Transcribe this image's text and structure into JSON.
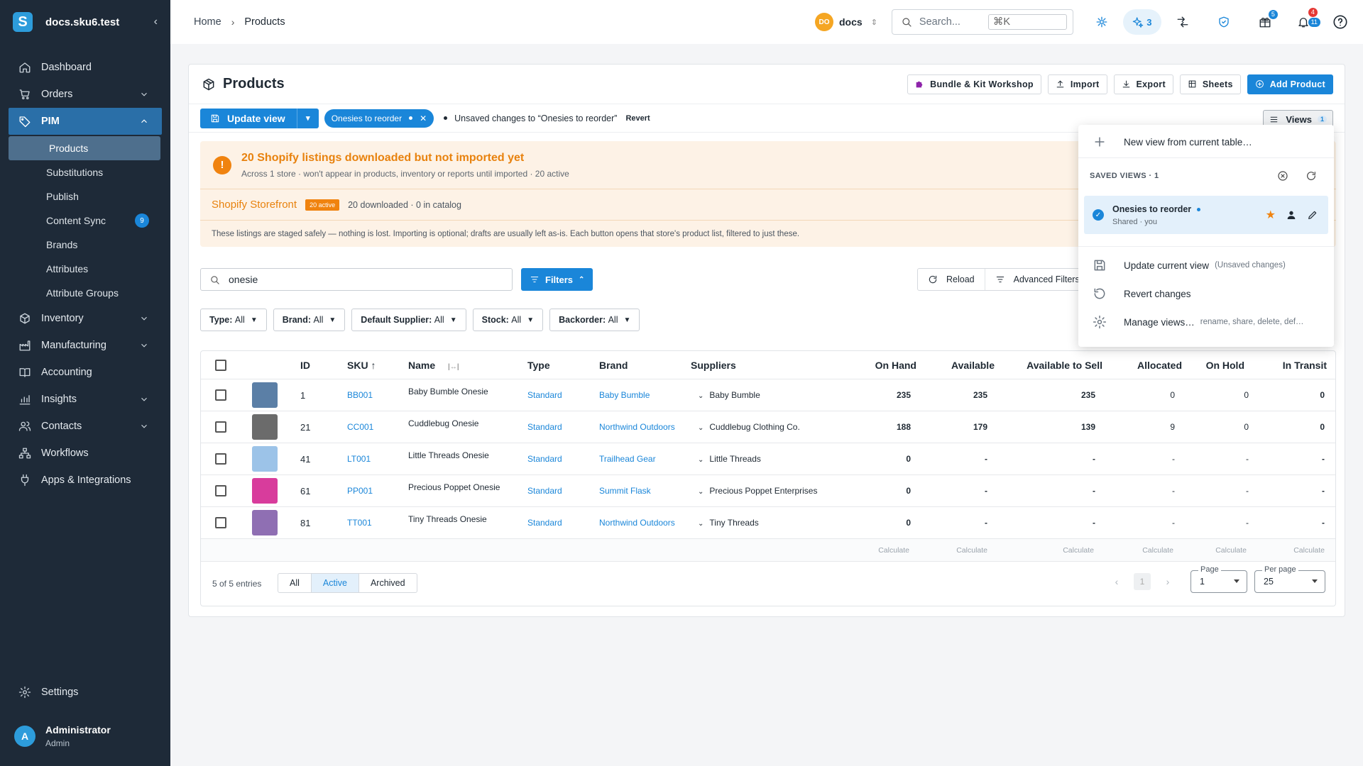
{
  "sidebar": {
    "logo": "S",
    "title": "docs.sku6.test",
    "collapse": "‹",
    "nav": [
      {
        "label": "Dashboard",
        "icon": "home-icon"
      },
      {
        "label": "Orders",
        "icon": "cart-icon"
      },
      {
        "label": "PIM",
        "icon": "tag-icon"
      },
      {
        "label": "Inventory",
        "icon": "box-icon"
      },
      {
        "label": "Manufacturing",
        "icon": "factory-icon"
      },
      {
        "label": "Accounting",
        "icon": "book-icon"
      },
      {
        "label": "Insights",
        "icon": "chart-icon"
      },
      {
        "label": "Contacts",
        "icon": "contacts-icon"
      },
      {
        "label": "Workflows",
        "icon": "workflow-icon"
      },
      {
        "label": "Apps & Integrations",
        "icon": "plug-icon"
      }
    ],
    "pim_sub": [
      "Products",
      "Substitutions",
      "Publish",
      "Content Sync",
      "Brands",
      "Attributes",
      "Attribute Groups"
    ],
    "content_sync_badge": "9",
    "settings": "Settings",
    "user": {
      "initial": "A",
      "name": "Administrator",
      "role": "Admin"
    }
  },
  "topbar": {
    "crumbs": [
      "Home",
      "Products"
    ],
    "crumb_sep": "›",
    "workspace": {
      "initials": "DO",
      "name": "docs"
    },
    "search_placeholder": "Search...",
    "search_kbd": "⌘K",
    "ai_count": "3",
    "gift_badge": "5",
    "notif_badge_top": "4",
    "notif_badge_bottom": "11"
  },
  "page": {
    "title": "Products",
    "buttons": {
      "bundle": "Bundle & Kit Workshop",
      "import": "Import",
      "export": "Export",
      "sheets": "Sheets",
      "add": "Add Product"
    },
    "update_view": "Update view",
    "view_chip": "Onesies to reorder",
    "unsaved_text": "Unsaved changes to “Onesies to reorder”",
    "revert": "Revert",
    "views_label": "Views",
    "views_count": "1"
  },
  "alert": {
    "title": "20 Shopify listings downloaded but not imported yet",
    "subtitle": "Across 1 store · won't appear in products, inventory or reports until imported · 20 active",
    "store": "Shopify Storefront",
    "store_badge": "20 active",
    "store_meta": "20 downloaded · 0 in catalog",
    "footnote": "These listings are staged safely — nothing is lost. Importing is optional; drafts are usually left as-is. Each button opens that store's product list, filtered to just these."
  },
  "toolbar": {
    "search_value": "onesie",
    "filters": "Filters",
    "reload": "Reload",
    "advanced": "Advanced Filters",
    "filter_selects": [
      {
        "label": "Type:",
        "value": "All"
      },
      {
        "label": "Brand:",
        "value": "All"
      },
      {
        "label": "Default Supplier:",
        "value": "All"
      },
      {
        "label": "Stock:",
        "value": "All"
      },
      {
        "label": "Backorder:",
        "value": "All"
      }
    ]
  },
  "table": {
    "columns": [
      "ID",
      "SKU",
      "Name",
      "Type",
      "Brand",
      "Suppliers",
      "On Hand",
      "Available",
      "Available to Sell",
      "Allocated",
      "On Hold",
      "In Transit"
    ],
    "rows": [
      {
        "id": "1",
        "sku": "BB001",
        "name": "Baby Bumble Onesie",
        "type": "Standard",
        "brand": "Baby Bumble",
        "supplier": "Baby Bumble",
        "on_hand": "235",
        "available": "235",
        "ats": "235",
        "allocated": "0",
        "on_hold": "0",
        "in_transit": "0",
        "thumb": "#5b7fa6"
      },
      {
        "id": "21",
        "sku": "CC001",
        "name": "Cuddlebug Onesie",
        "type": "Standard",
        "brand": "Northwind Outdoors",
        "supplier": "Cuddlebug Clothing Co.",
        "on_hand": "188",
        "available": "179",
        "ats": "139",
        "allocated": "9",
        "on_hold": "0",
        "in_transit": "0",
        "thumb": "#6b6b6b"
      },
      {
        "id": "41",
        "sku": "LT001",
        "name": "Little Threads Onesie",
        "type": "Standard",
        "brand": "Trailhead Gear",
        "supplier": "Little Threads",
        "on_hand": "0",
        "available": "-",
        "ats": "-",
        "allocated": "-",
        "on_hold": "-",
        "in_transit": "-",
        "thumb": "#9cc3e8"
      },
      {
        "id": "61",
        "sku": "PP001",
        "name": "Precious Poppet Onesie",
        "type": "Standard",
        "brand": "Summit Flask",
        "supplier": "Precious Poppet Enterprises",
        "on_hand": "0",
        "available": "-",
        "ats": "-",
        "allocated": "-",
        "on_hold": "-",
        "in_transit": "-",
        "thumb": "#d83c9c"
      },
      {
        "id": "81",
        "sku": "TT001",
        "name": "Tiny Threads Onesie",
        "type": "Standard",
        "brand": "Northwind Outdoors",
        "supplier": "Tiny Threads",
        "on_hand": "0",
        "available": "-",
        "ats": "-",
        "allocated": "-",
        "on_hold": "-",
        "in_transit": "-",
        "thumb": "#8f6fb3"
      }
    ],
    "calculate": "Calculate",
    "entries": "5 of 5 entries",
    "segments": [
      "All",
      "Active",
      "Archived"
    ],
    "page_label": "Page",
    "page_value": "1",
    "per_page_label": "Per page",
    "per_page_value": "25",
    "current_page": "1"
  },
  "views_menu": {
    "new_view": "New view from current table…",
    "section": "SAVED VIEWS · 1",
    "saved": {
      "name": "Onesies to reorder",
      "meta": "Shared · you"
    },
    "update": "Update current view",
    "update_hint": "(Unsaved changes)",
    "revert": "Revert changes",
    "manage": "Manage views…",
    "manage_hint": "rename, share, delete, def…"
  },
  "colors": {
    "sidebar": "#1e2a38",
    "accent": "#1a86d9",
    "warning": "#e8820e"
  }
}
